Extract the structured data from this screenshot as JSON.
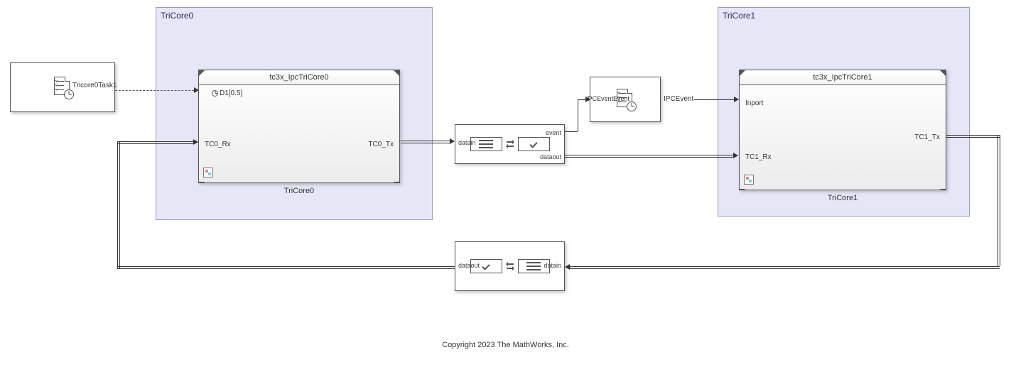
{
  "regions": {
    "tricore0": {
      "label": "TriCore0"
    },
    "tricore1": {
      "label": "TriCore1"
    }
  },
  "blocks": {
    "task0": {
      "out_label": "Tricore0Task1"
    },
    "core0_ref": {
      "title": "tc3x_IpcTriCore0",
      "name_below": "TriCore0",
      "port_d1": "D1[0.5]",
      "port_rx": "TC0_Rx",
      "port_tx": "TC0_Tx"
    },
    "ipc_top": {
      "port_in": "datain",
      "port_event": "event",
      "port_out": "dataout"
    },
    "event_task": {
      "left_label": "IPCEventEvent",
      "out_label": "IPCEvent"
    },
    "core1_ref": {
      "title": "tc3x_IpcTriCore1",
      "name_below": "TriCore1",
      "port_inport": "Inport",
      "port_rx": "TC1_Rx",
      "port_tx": "TC1_Tx"
    },
    "ipc_bottom": {
      "port_in": "datain",
      "port_out": "dataout"
    }
  },
  "footer": {
    "copyright": "Copyright 2023 The MathWorks, Inc."
  }
}
